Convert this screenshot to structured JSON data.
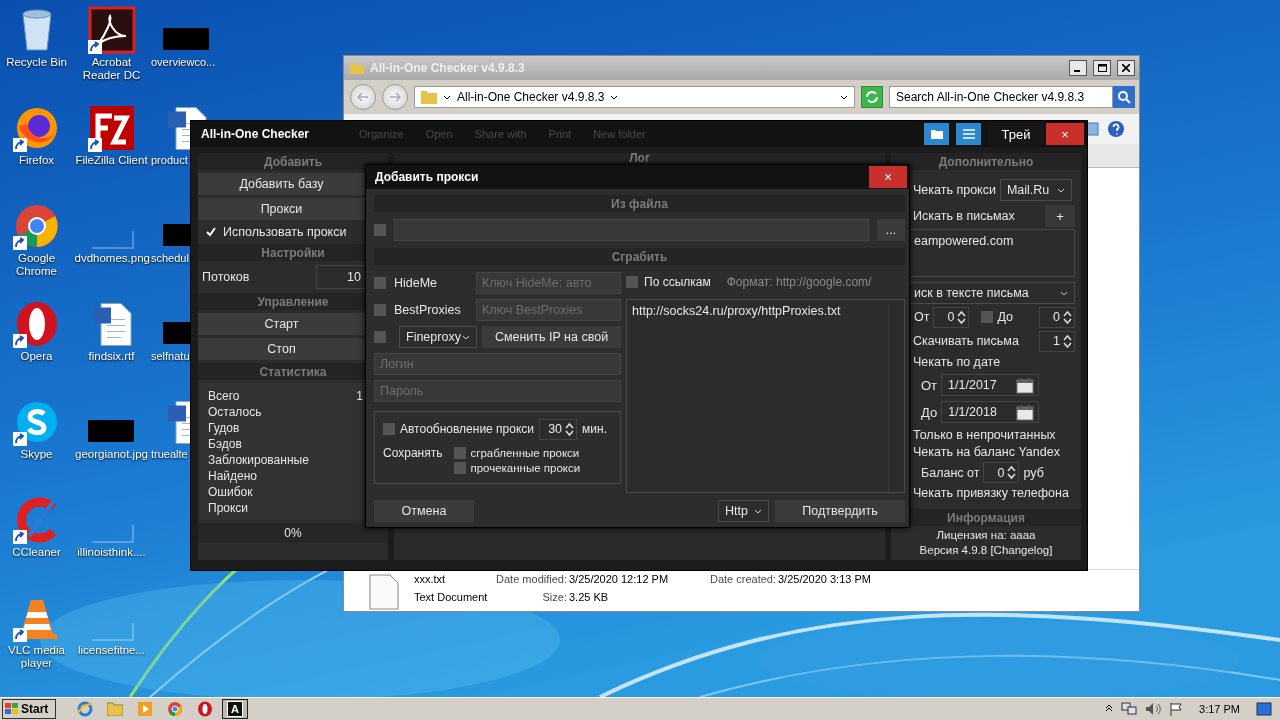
{
  "desktop_icons": [
    {
      "label": "Recycle Bin",
      "kind": "trash",
      "shortcut": false
    },
    {
      "label": "Firefox",
      "kind": "firefox",
      "shortcut": true
    },
    {
      "label": "Google Chrome",
      "kind": "chrome",
      "shortcut": true
    },
    {
      "label": "Opera",
      "kind": "opera",
      "shortcut": true
    },
    {
      "label": "Skype",
      "kind": "skype",
      "shortcut": true
    },
    {
      "label": "CCleaner",
      "kind": "ccleaner",
      "shortcut": true
    },
    {
      "label": "VLC media player",
      "kind": "vlc",
      "shortcut": true
    },
    {
      "label": "Acrobat Reader DC",
      "kind": "acrobat",
      "shortcut": true
    },
    {
      "label": "FileZilla Client",
      "kind": "filezilla",
      "shortcut": true
    },
    {
      "label": "dvdhomes.png",
      "kind": "blank",
      "shortcut": false
    },
    {
      "label": "findsix.rtf",
      "kind": "word",
      "shortcut": false
    },
    {
      "label": "georgianot.jpg",
      "kind": "redacted",
      "shortcut": false
    },
    {
      "label": "illinoisthink....",
      "kind": "blank",
      "shortcut": false
    },
    {
      "label": "licensefitne...",
      "kind": "blank",
      "shortcut": false
    },
    {
      "label": "overviewco...",
      "kind": "redacted",
      "shortcut": false
    },
    {
      "label": "product",
      "kind": "word",
      "shortcut": false
    },
    {
      "label": "schedul",
      "kind": "redacted",
      "shortcut": false
    },
    {
      "label": "selfnatu",
      "kind": "redacted",
      "shortcut": false
    },
    {
      "label": "truealte",
      "kind": "word",
      "shortcut": false
    }
  ],
  "explorer": {
    "title": "All-in-One Checker v4.9.8.3",
    "address": "All-in-One Checker v4.9.8.3",
    "search": {
      "placeholder": "Search All-in-One Checker v4.9.8.3"
    },
    "toolbar": [
      "Organize",
      "Open",
      "Share with",
      "Print",
      "New folder"
    ],
    "details": {
      "name": "xxx.txt",
      "type": "Text Document",
      "fields": [
        {
          "label": "Date modified:",
          "value": "3/25/2020 12:12 PM"
        },
        {
          "label": "Date created:",
          "value": "3/25/2020 3:13 PM"
        },
        {
          "label": "Size:",
          "value": "3.25 KB"
        }
      ]
    }
  },
  "app": {
    "title": "All-in-One Checker",
    "title_buttons": [
      {
        "kind": "folder"
      },
      {
        "kind": "menu"
      },
      {
        "kind": "text",
        "label": "Трей"
      },
      {
        "kind": "close",
        "label": "×"
      }
    ],
    "left_panel": [
      {
        "kind": "header",
        "label": "Добавить"
      },
      {
        "kind": "button",
        "label": "Добавить базу"
      },
      {
        "kind": "button",
        "label": "Прокси"
      },
      {
        "kind": "checkbox",
        "label": "Использовать прокси",
        "checked": true
      },
      {
        "kind": "header",
        "label": "Настройки"
      },
      {
        "kind": "field",
        "label": "Потоков",
        "value": "10"
      },
      {
        "kind": "header",
        "label": "Управление"
      },
      {
        "kind": "button",
        "label": "Старт"
      },
      {
        "kind": "button",
        "label": "Стоп"
      },
      {
        "kind": "header",
        "label": "Статистика"
      },
      {
        "kind": "stats",
        "rows": [
          {
            "label": "Всего",
            "value": "1"
          },
          {
            "label": "Осталось"
          },
          {
            "label": "Гудов"
          },
          {
            "label": "Бэдов"
          },
          {
            "label": "Заблокированные"
          },
          {
            "label": "Найдено"
          },
          {
            "label": "Ошибок"
          },
          {
            "label": "Прокси"
          }
        ]
      },
      {
        "kind": "progress",
        "label": "0%",
        "level": 0
      }
    ],
    "log_header": "Лог",
    "right_panel": {
      "header": "Дополнительно",
      "check_proxy_label": "Чекать прокси",
      "check_proxy_value": "Mail.Ru",
      "search_label": "Искать в письмах",
      "add_button": "+",
      "search_text": "eampowered.com",
      "search_mode": "иск в тексте письма",
      "from_label": "От",
      "from_value": "0",
      "to_checked": false,
      "to_label": "До",
      "to_value": "0",
      "download_label": "Скачивать письма",
      "download_value": "1",
      "date_label": "Чекать по дате",
      "date_from_label": "От",
      "date_from": "1/1/2017",
      "date_to_label": "До",
      "date_to": "1/1/2018",
      "unread_label": "Только в непрочитанных",
      "balance_check_label": "Чекать на баланс Yandex",
      "balance_label": "Баланс от",
      "balance_value": "0",
      "balance_unit": "руб",
      "phone_label": "Чекать привязку телефона",
      "info_header": "Информация",
      "license": "Лицензия на: aaaa",
      "version": "Версия 4.9.8 [Changelog]"
    }
  },
  "dialog": {
    "title": "Добавить прокси",
    "close": "×",
    "file_header": "Из файла",
    "file_checked": false,
    "browse": "...",
    "grab_header": "Сграбить",
    "sources": [
      {
        "kind": "key",
        "label": "HideMe",
        "checked": false,
        "placeholder": "Ключ HideMe: авто"
      },
      {
        "kind": "key",
        "label": "BestProxies",
        "checked": false,
        "placeholder": "Ключ BestProxies"
      },
      {
        "kind": "select",
        "label": "Fineproxy",
        "checked": false,
        "button": "Сменить IP на свой"
      }
    ],
    "login": {
      "placeholder": "Логин"
    },
    "password": {
      "placeholder": "Пароль"
    },
    "auto_update": {
      "label": "Автообновление прокси",
      "checked": false,
      "value": "30",
      "unit": "мин."
    },
    "save_label": "Сохранять",
    "save_options": [
      {
        "label": "сграбленные прокси",
        "checked": false
      },
      {
        "label": "прочеканные прокси",
        "checked": false
      }
    ],
    "links": {
      "label": "По ссылкам",
      "checked": false,
      "hint": "Формат: http://google.com/",
      "text": "http://socks24.ru/proxy/httpProxies.txt"
    },
    "cancel": "Отмена",
    "protocol": "Http",
    "confirm": "Подтвердить"
  },
  "taskbar": {
    "start": "Start",
    "apps": [
      {
        "kind": "ie",
        "active": false
      },
      {
        "kind": "folder",
        "active": false
      },
      {
        "kind": "media",
        "active": false
      },
      {
        "kind": "chrome",
        "active": false
      },
      {
        "kind": "opera",
        "active": false
      },
      {
        "kind": "app",
        "active": true,
        "glyph": "A"
      }
    ],
    "clock": "3:17 PM"
  }
}
